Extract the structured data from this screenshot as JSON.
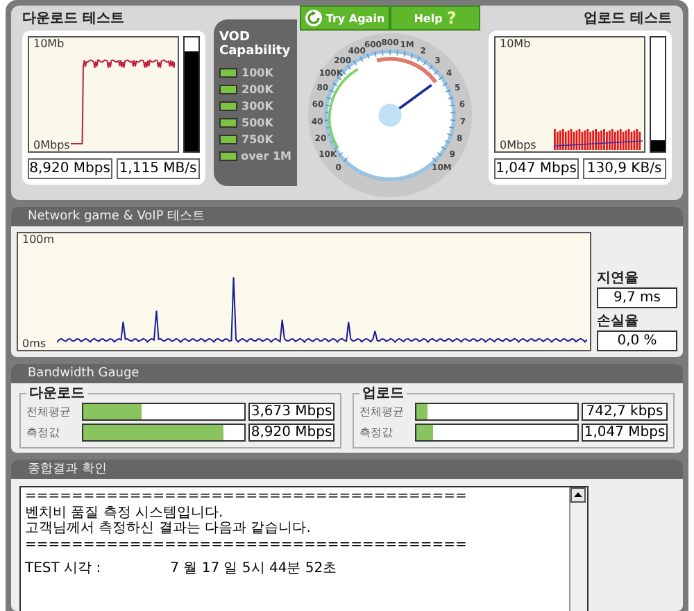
{
  "download": {
    "title": "다운로드 테스트",
    "graph": {
      "top_label": "10Mb",
      "bottom_label": "0Mbps"
    },
    "meter": {
      "level": 0.88
    },
    "readouts": [
      "8,920 Mbps",
      "1,115 MB/s"
    ]
  },
  "vod": {
    "title": "VOD Capability",
    "items": [
      {
        "label": "100K",
        "on": true
      },
      {
        "label": "200K",
        "on": true
      },
      {
        "label": "300K",
        "on": true
      },
      {
        "label": "500K",
        "on": true
      },
      {
        "label": "750K",
        "on": true
      },
      {
        "label": "over 1M",
        "on": true
      }
    ]
  },
  "buttons": [
    {
      "label": "Try Again",
      "kind": "refresh"
    },
    {
      "label": "Help",
      "kind": "help",
      "icon": "?"
    }
  ],
  "gauge": {
    "left_labels": [
      "100K",
      "80",
      "60",
      "40",
      "20",
      "10K",
      "0"
    ],
    "right_labels": [
      "200",
      "400",
      "600",
      "800",
      "1M",
      "2",
      "3",
      "4",
      "5",
      "6",
      "7",
      "8",
      "9",
      "10M"
    ],
    "level": 0.7
  },
  "upload": {
    "title": "업로드 테스트",
    "graph": {
      "top_label": "10Mb",
      "bottom_label": "0Mbps"
    },
    "meter": {
      "level": 0.1
    },
    "readouts": [
      "1,047 Mbps",
      "130,9 KB/s"
    ]
  },
  "network": {
    "title": "Network game & VoIP 테스트",
    "graph": {
      "top_label": "100m",
      "bottom_label": "0ms"
    },
    "stats": [
      {
        "label": "지연율",
        "value": "9,7 ms"
      },
      {
        "label": "손실율",
        "value": "0,0 %"
      }
    ]
  },
  "bandwidth": {
    "title": "Bandwidth Gauge",
    "groups": [
      {
        "title": "다운로드",
        "rows": [
          {
            "label": "전체평균",
            "level": 0.36,
            "value": "3,673 Mbps"
          },
          {
            "label": "측정값",
            "level": 0.87,
            "value": "8,920 Mbps"
          }
        ]
      },
      {
        "title": "업로드",
        "rows": [
          {
            "label": "전체평균",
            "level": 0.07,
            "value": "742,7 kbps"
          },
          {
            "label": "측정값",
            "level": 0.1,
            "value": "1,047 Mbps"
          }
        ]
      }
    ]
  },
  "result": {
    "title": "종합결과 확인",
    "lines": [
      "======================================",
      "벤치비 품질 측정 시스템입니다.",
      "고객님께서 측정하신 결과는 다음과 같습니다.",
      "======================================"
    ],
    "time_row": {
      "label": "TEST 시각 :",
      "value": "7 월 17 일  5시 44분 52초"
    }
  }
}
